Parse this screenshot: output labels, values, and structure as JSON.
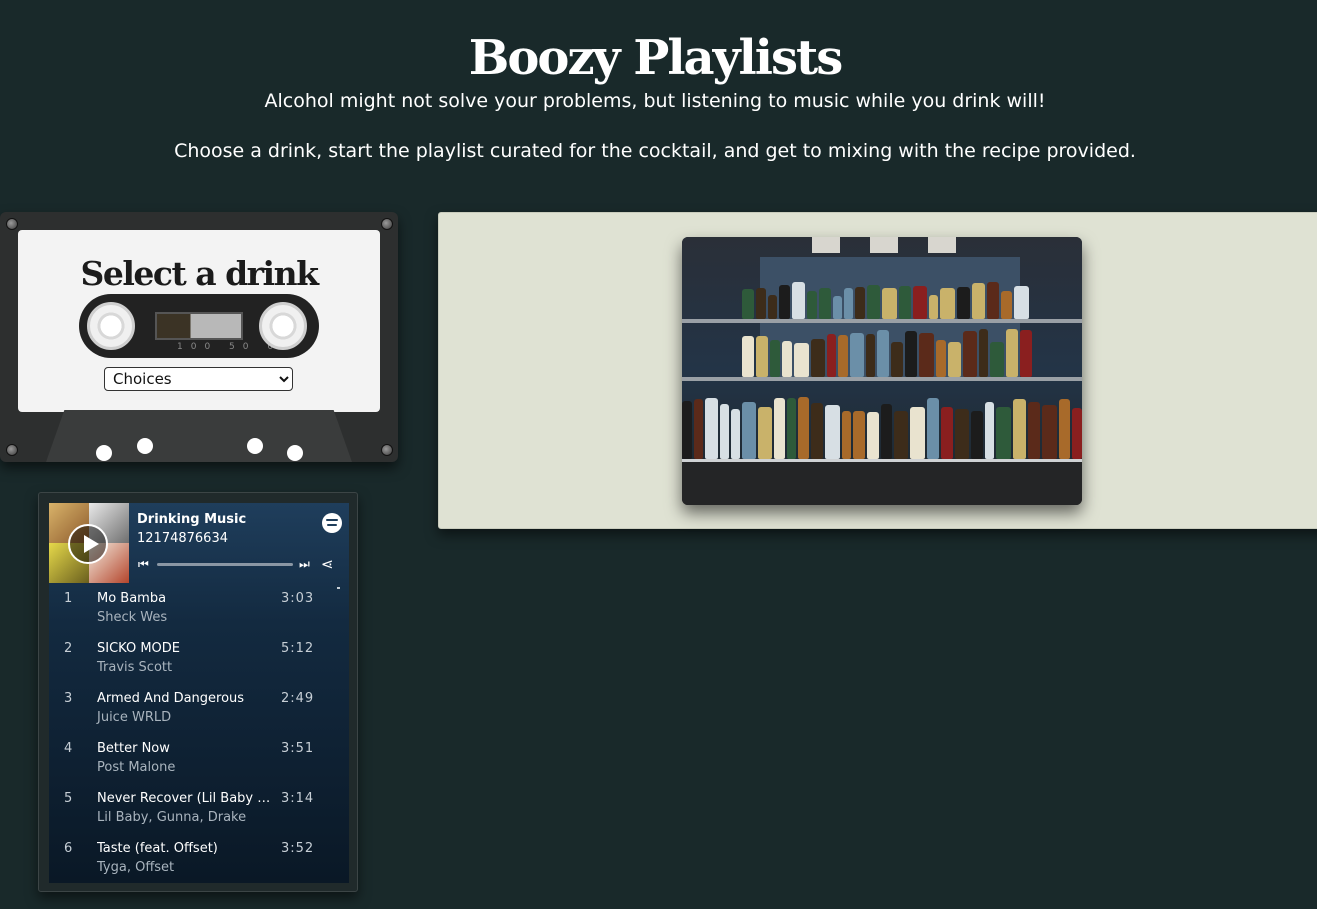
{
  "header": {
    "title": "Boozy Playlists",
    "tagline": "Alcohol might not solve your problems, but listening to music while you drink will!",
    "instructions": "Choose a drink, start the playlist curated for the cocktail, and get to mixing with the recipe provided."
  },
  "selector": {
    "label": "Select a drink",
    "selected": "Choices"
  },
  "cassette_text": "100  50  0",
  "spotify": {
    "playlist_name": "Drinking Music",
    "owner": "12174876634",
    "tracks": [
      {
        "num": "1",
        "name": "Mo Bamba",
        "artist": "Sheck Wes",
        "duration": "3:03"
      },
      {
        "num": "2",
        "name": "SICKO MODE",
        "artist": "Travis Scott",
        "duration": "5:12"
      },
      {
        "num": "3",
        "name": "Armed And Dangerous",
        "artist": "Juice WRLD",
        "duration": "2:49"
      },
      {
        "num": "4",
        "name": "Better Now",
        "artist": "Post Malone",
        "duration": "3:51"
      },
      {
        "num": "5",
        "name": "Never Recover (Lil Baby & ...",
        "artist": "Lil Baby, Gunna, Drake",
        "duration": "3:14"
      },
      {
        "num": "6",
        "name": "Taste (feat. Offset)",
        "artist": "Tyga, Offset",
        "duration": "3:52"
      }
    ],
    "icons": {
      "logo": "spotify-logo-icon",
      "play": "play-icon",
      "prev": "skip-back-icon",
      "next": "skip-forward-icon",
      "share": "share-icon"
    }
  },
  "colors": {
    "background": "#19292a",
    "panel": "#dfe2d3",
    "spotify_top": "#1f3e5c"
  }
}
